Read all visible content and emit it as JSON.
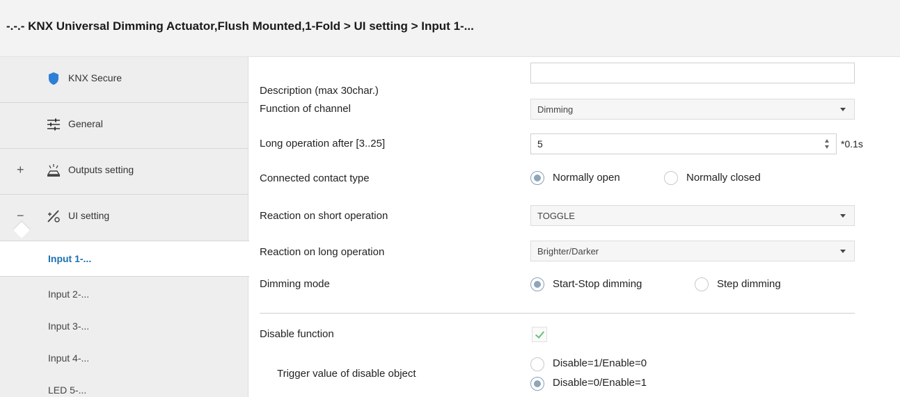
{
  "title": {
    "breadcrumb": "-.-.- KNX Universal Dimming Actuator,Flush Mounted,1-Fold > UI setting > Input 1-..."
  },
  "colors": {
    "accent": "#1c6fb0",
    "selected_radio": "#8fa5b9",
    "checkmark": "#6bbf7a",
    "shield": "#2f7fd6"
  },
  "sidebar": {
    "items": [
      {
        "label": "KNX Secure",
        "icon": "shield-icon",
        "expander": ""
      },
      {
        "label": "General",
        "icon": "sliders-icon",
        "expander": ""
      },
      {
        "label": "Outputs setting",
        "icon": "lamp-icon",
        "expander": "+"
      },
      {
        "label": "UI setting",
        "icon": "ui-setting-icon",
        "expander": "−"
      }
    ],
    "subitems": [
      {
        "label": "Input 1-...",
        "selected": true
      },
      {
        "label": "Input 2-...",
        "selected": false
      },
      {
        "label": "Input 3-...",
        "selected": false
      },
      {
        "label": "Input 4-...",
        "selected": false
      },
      {
        "label": "LED 5-...",
        "selected": false
      }
    ]
  },
  "params": {
    "description": {
      "label": "Description (max 30char.)",
      "value": ""
    },
    "function": {
      "label": "Function of channel",
      "value": "Dimming"
    },
    "long_op": {
      "label": "Long operation after [3..25]",
      "value": "5",
      "unit": "*0.1s"
    },
    "contact": {
      "label": "Connected contact type",
      "options": [
        "Normally open",
        "Normally closed"
      ],
      "selected": "Normally open"
    },
    "short_reaction": {
      "label": "Reaction on short operation",
      "value": "TOGGLE"
    },
    "long_reaction": {
      "label": "Reaction on long operation",
      "value": "Brighter/Darker"
    },
    "dimming_mode": {
      "label": "Dimming mode",
      "options": [
        "Start-Stop dimming",
        "Step dimming"
      ],
      "selected": "Start-Stop dimming"
    },
    "disable": {
      "label": "Disable function",
      "checked": true
    },
    "trigger": {
      "label": "Trigger value of disable object",
      "options": [
        "Disable=1/Enable=0",
        "Disable=0/Enable=1"
      ],
      "selected": "Disable=0/Enable=1"
    }
  }
}
